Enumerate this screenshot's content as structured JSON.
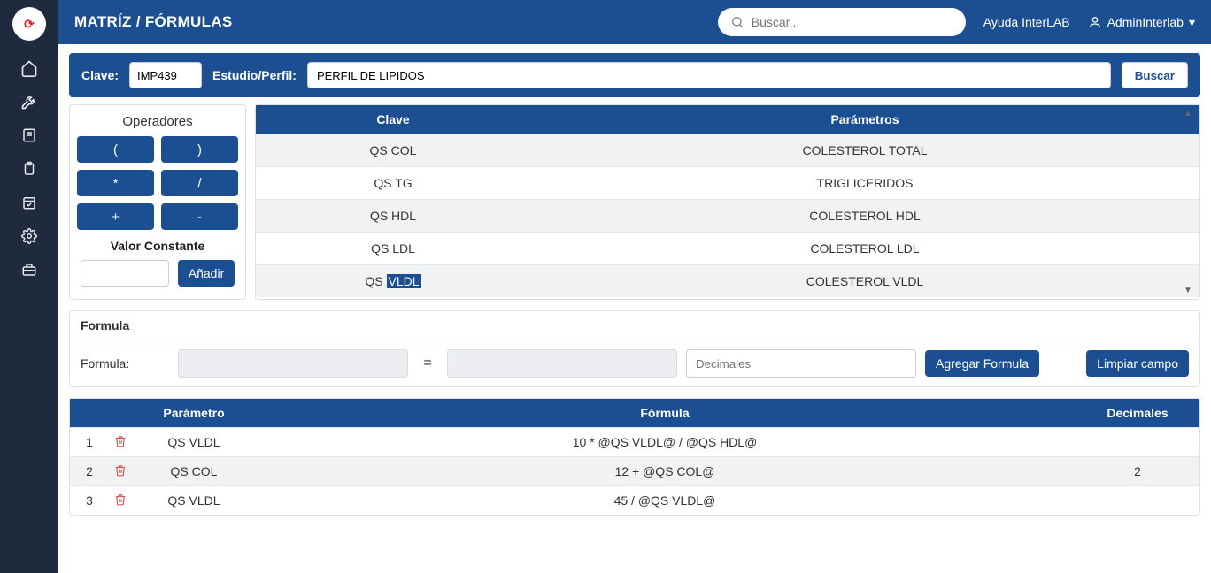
{
  "topbar": {
    "title": "MATRÍZ / FÓRMULAS",
    "search_placeholder": "Buscar...",
    "help_label": "Ayuda InterLAB",
    "user_label": "AdminInterlab"
  },
  "filter": {
    "clave_label": "Clave:",
    "clave_value": "IMP439",
    "perfil_label": "Estudio/Perfil:",
    "perfil_value": "PERFIL DE LIPIDOS",
    "search_btn": "Buscar"
  },
  "ops": {
    "title": "Operadores",
    "buttons": [
      "(",
      ")",
      "*",
      "/",
      "+",
      "-"
    ],
    "const_title": "Valor Constante",
    "add_btn": "Añadir"
  },
  "params": {
    "head_clave": "Clave",
    "head_param": "Parámetros",
    "rows": [
      {
        "clave_pre": "QS COL",
        "hl": "",
        "param": "COLESTEROL TOTAL"
      },
      {
        "clave_pre": "QS TG",
        "hl": "",
        "param": "TRIGLICERIDOS"
      },
      {
        "clave_pre": "QS HDL",
        "hl": "",
        "param": "COLESTEROL HDL"
      },
      {
        "clave_pre": "QS LDL",
        "hl": "",
        "param": "COLESTEROL LDL"
      },
      {
        "clave_pre": "QS ",
        "hl": "VLDL",
        "param": "COLESTEROL VLDL"
      }
    ]
  },
  "formula": {
    "card_title": "Formula",
    "row_label": "Formula:",
    "eq": "=",
    "dec_placeholder": "Decimales",
    "add_btn": "Agregar Formula",
    "clear_btn": "Limpiar campo"
  },
  "ftable": {
    "head_param": "Parámetro",
    "head_formula": "Fórmula",
    "head_dec": "Decimales",
    "rows": [
      {
        "n": "1",
        "param": "QS VLDL",
        "formula": "10 * @QS VLDL@ / @QS HDL@",
        "dec": ""
      },
      {
        "n": "2",
        "param": "QS COL",
        "formula": "12 + @QS COL@",
        "dec": "2"
      },
      {
        "n": "3",
        "param": "QS VLDL",
        "formula": "45 / @QS VLDL@",
        "dec": ""
      }
    ]
  }
}
